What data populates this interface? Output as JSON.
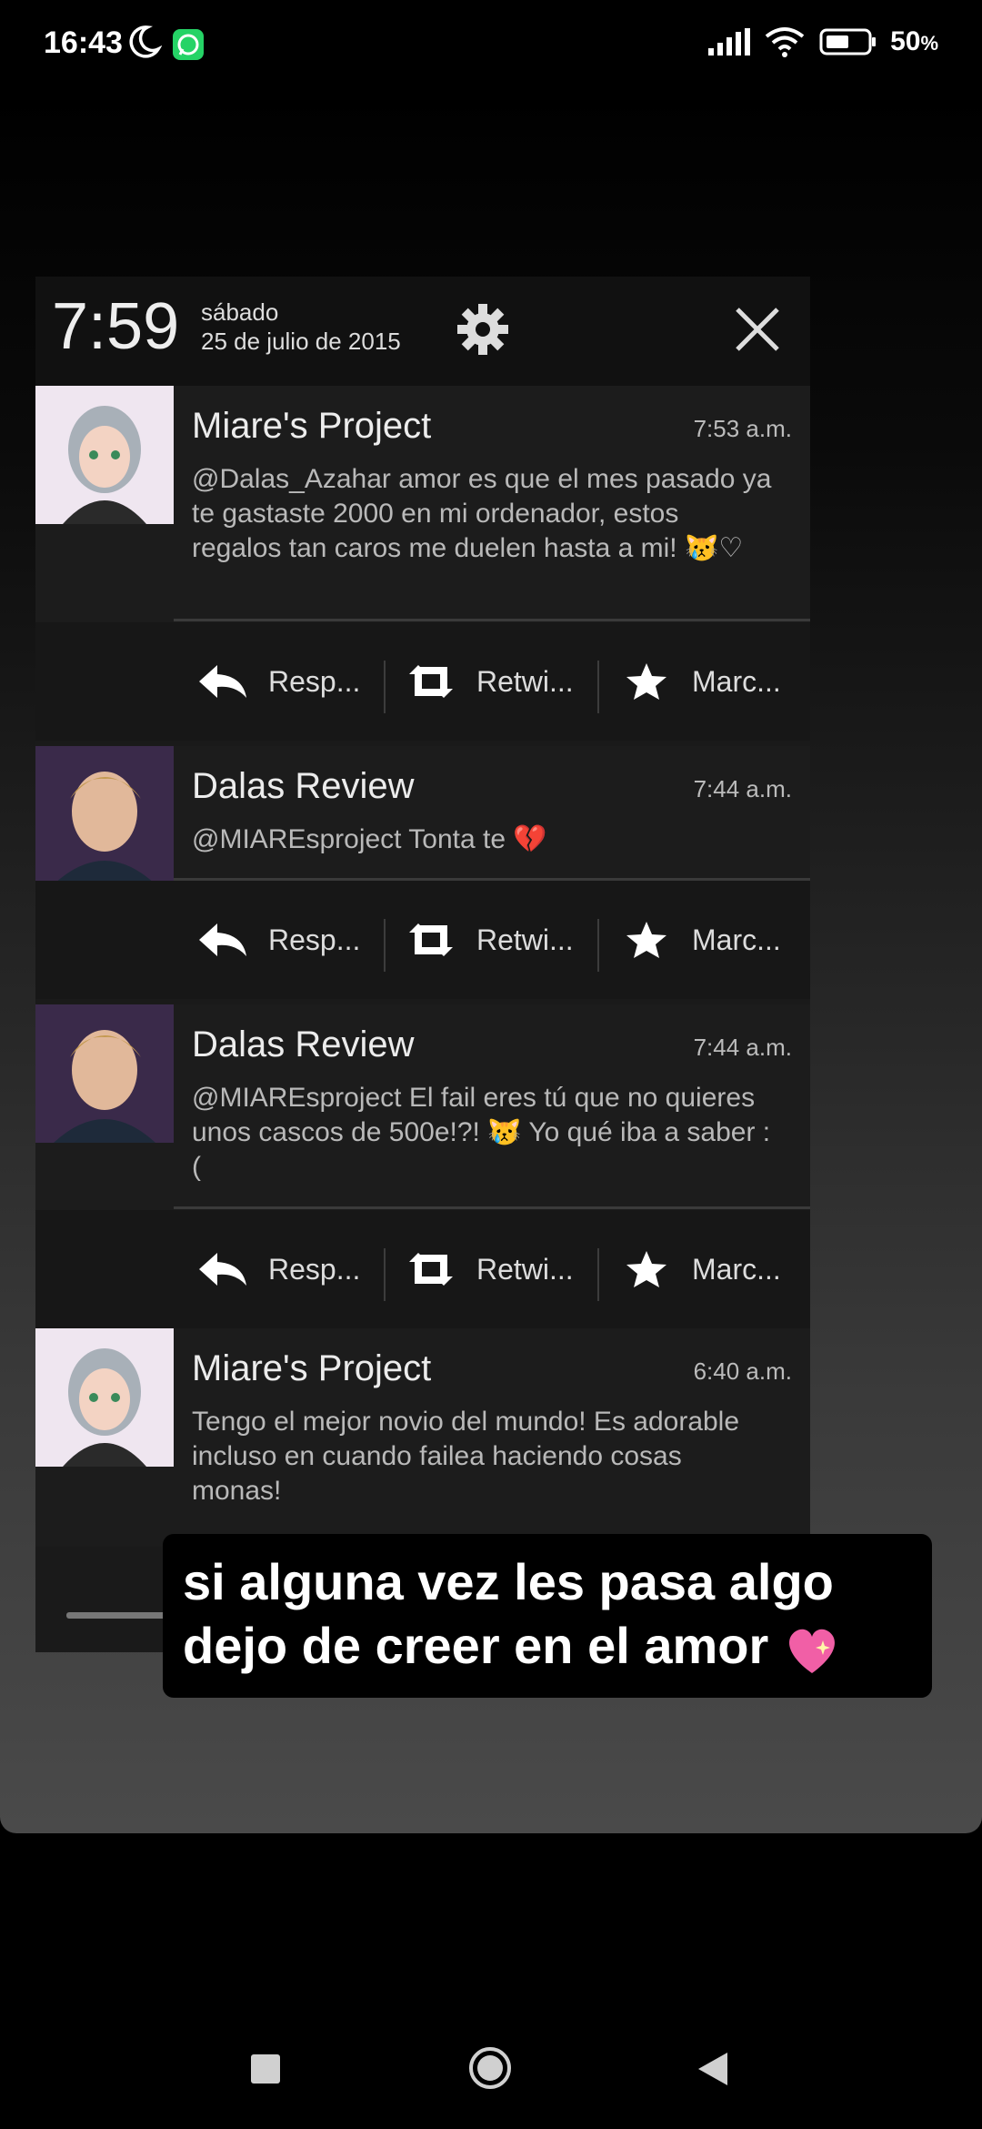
{
  "status_bar": {
    "time": "16:43",
    "battery_percent": "50",
    "percent_sign": "%",
    "icons": [
      "moon-icon",
      "whatsapp-icon",
      "signal-icon",
      "wifi-icon",
      "battery-icon"
    ]
  },
  "screenshot": {
    "header": {
      "time": "7:59",
      "day": "sábado",
      "date": "25 de julio de 2015"
    },
    "notifications": [
      {
        "title": "Miare's Project",
        "time": "7:53 a.m.",
        "text": "@Dalas_Azahar amor es que el mes pasado ya te gastaste 2000 en mi ordenador, estos regalos tan caros me duelen hasta a mi! 😿♡"
      },
      {
        "title": "Dalas Review",
        "time": "7:44 a.m.",
        "text": "@MIAREsproject Tonta      te 💔"
      },
      {
        "title": "Dalas Review",
        "time": "7:44 a.m.",
        "text": "@MIAREsproject El fail eres tú que no quieres unos cascos de 500e!?! 😿 Yo qué iba a saber :("
      },
      {
        "title": "Miare's Project",
        "time": "6:40 a.m.",
        "text": "Tengo el mejor novio del mundo! Es adorable incluso en cuando failea haciendo cosas monas!"
      }
    ],
    "actions": {
      "reply": "Resp...",
      "retweet": "Retwi...",
      "favorite": "Marc..."
    }
  },
  "caption": {
    "line1": "si alguna vez les pasa algo",
    "line2": "dejo de creer en el amor"
  },
  "colors": {
    "whatsapp": "#25D366",
    "background": "#000000",
    "card": "#1c1c1c"
  }
}
